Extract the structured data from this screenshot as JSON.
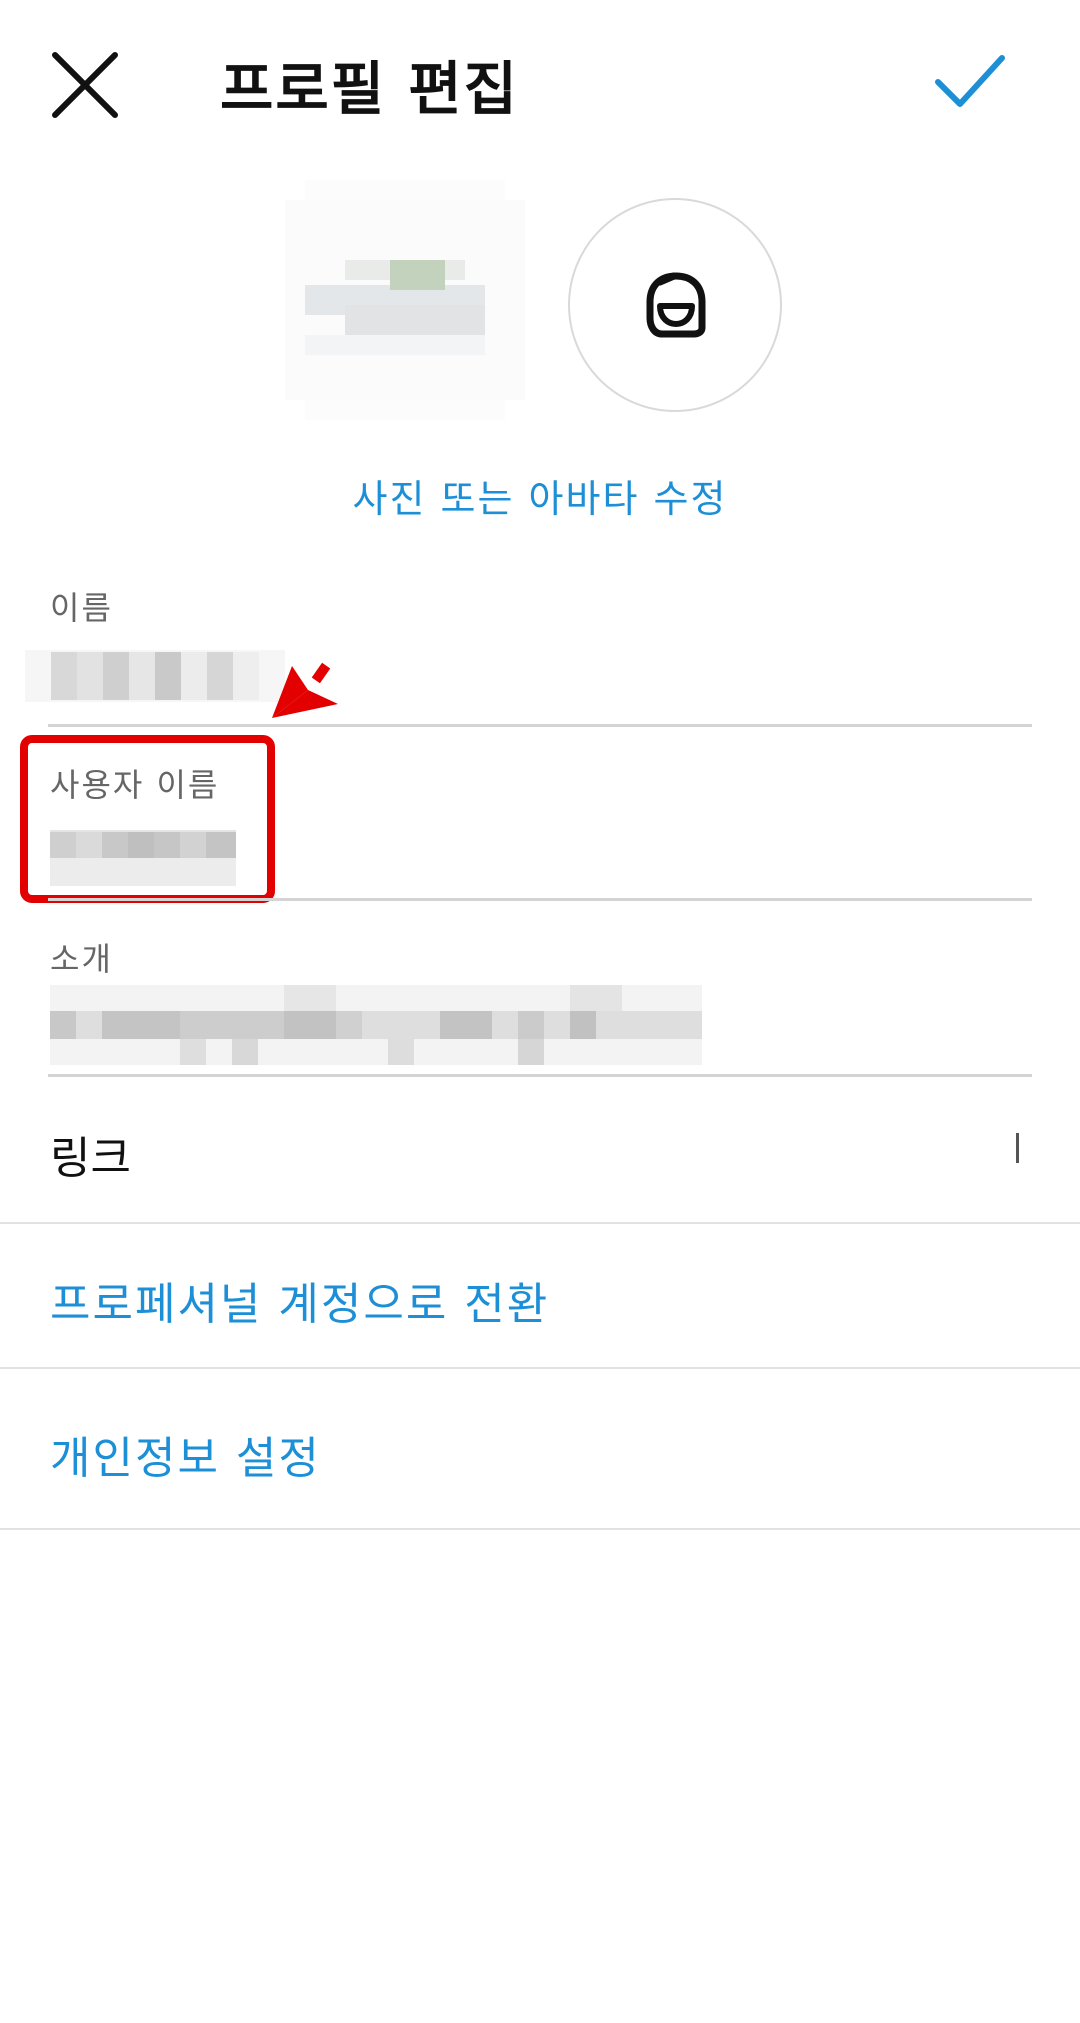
{
  "header": {
    "title": "프로필 편집",
    "close_icon": "close-icon",
    "confirm_icon": "checkmark-icon",
    "accent_color": "#1d8fd6"
  },
  "avatar": {
    "profile_photo": "pixelated-profile-photo",
    "avatar_icon": "avatar-face-icon",
    "edit_label": "사진 또는 아바타 수정"
  },
  "fields": {
    "name": {
      "label": "이름"
    },
    "username": {
      "label": "사용자 이름"
    },
    "bio": {
      "label": "소개"
    }
  },
  "link_row": {
    "label": "링크"
  },
  "menu": {
    "professional": "프로페셔널 계정으로 전환",
    "privacy": "개인정보 설정"
  }
}
